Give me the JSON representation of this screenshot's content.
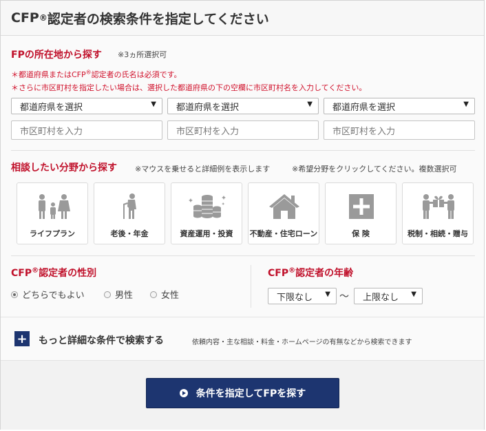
{
  "header": {
    "title_prefix": "CFP",
    "title_sup": "®",
    "title_suffix": "認定者の検索条件を指定してください"
  },
  "location": {
    "title": "FPの所在地から探す",
    "limit_note": "※3ヵ所選択可",
    "required_note_a": "＊都道府県またはCFP",
    "required_note_sup": "®",
    "required_note_b": "認定者の氏名は必須です。",
    "city_note": "＊さらに市区町村を指定したい場合は、選択した都道府県の下の空欄に市区町村名を入力してください。",
    "prefecture_selects": [
      "都道府県を選択",
      "都道府県を選択",
      "都道府県を選択"
    ],
    "city_inputs": [
      "市区町村を入力",
      "市区町村を入力",
      "市区町村を入力"
    ]
  },
  "field": {
    "title": "相談したい分野から探す",
    "hover_note": "※マウスを乗せると詳細例を表示します",
    "select_note": "※希望分野をクリックしてください。複数選択可",
    "categories": [
      {
        "label": "ライフプラン",
        "icon": "family-icon"
      },
      {
        "label": "老後・年金",
        "icon": "elderly-icon"
      },
      {
        "label": "資産運用・投資",
        "icon": "coins-icon"
      },
      {
        "label": "不動産・住宅ローン",
        "icon": "house-icon"
      },
      {
        "label": "保 険",
        "icon": "cross-icon"
      },
      {
        "label": "税制・相続・贈与",
        "icon": "gift-icon"
      }
    ]
  },
  "gender": {
    "title_prefix": "CFP",
    "title_sup": "®",
    "title_suffix": "認定者の性別",
    "options": [
      "どちらでもよい",
      "男性",
      "女性"
    ],
    "selected": "どちらでもよい"
  },
  "age": {
    "title_prefix": "CFP",
    "title_sup": "®",
    "title_suffix": "認定者の年齢",
    "min_select": "下限なし",
    "separator": "～",
    "max_select": "上限なし"
  },
  "more": {
    "label": "もっと詳細な条件で検索する",
    "note": "依頼内容・主な相談・料金・ホームページの有無などから検索できます"
  },
  "submit": {
    "label": "条件を指定してFPを探す"
  },
  "colors": {
    "accent_red": "#c0102a",
    "navy": "#1d3570",
    "icon_gray": "#9a9a9a"
  }
}
